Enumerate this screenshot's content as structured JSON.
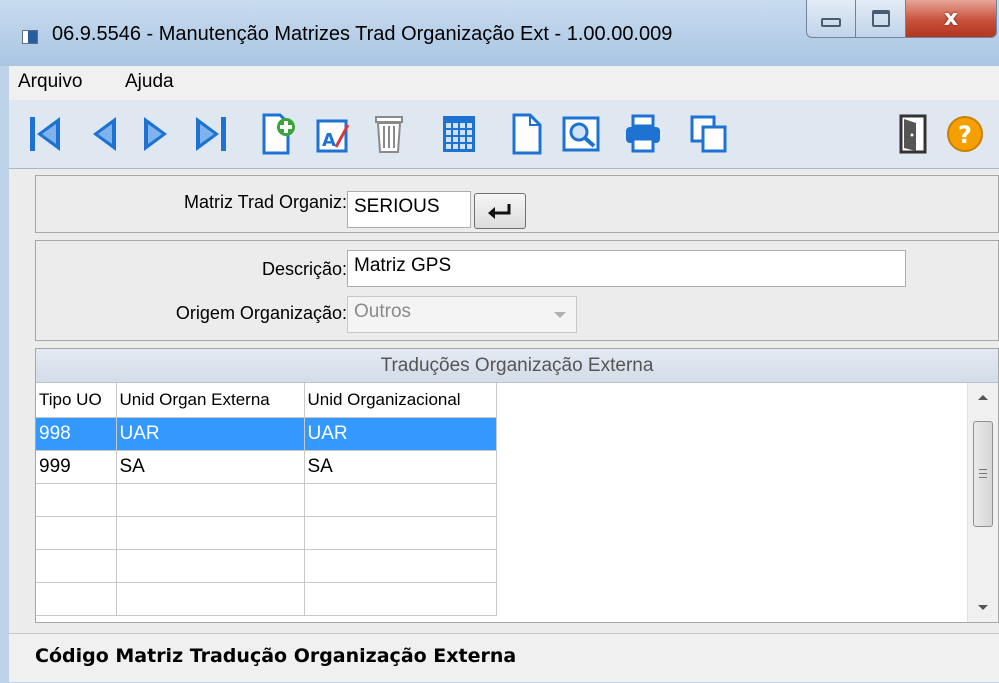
{
  "window": {
    "title": "06.9.5546 - Manutenção Matrizes Trad Organização Ext - 1.00.00.009"
  },
  "menu": {
    "items": [
      "Arquivo",
      "Ajuda"
    ]
  },
  "toolbar": {
    "icons": [
      "first-record-icon",
      "previous-record-icon",
      "next-record-icon",
      "last-record-icon",
      "add-record-icon",
      "edit-record-icon",
      "delete-record-icon",
      "calendar-grid-icon",
      "blank-document-icon",
      "print-preview-icon",
      "printer-icon",
      "copy-icon",
      "exit-door-icon",
      "help-icon"
    ]
  },
  "key_panel": {
    "label": "Matriz Trad Organiz:",
    "value": "SERIOUS"
  },
  "detail_panel": {
    "descricao_label": "Descrição:",
    "descricao_value": "Matriz GPS",
    "origem_label": "Origem Organização:",
    "origem_value": "Outros"
  },
  "grid": {
    "title": "Traduções Organização Externa",
    "columns": [
      "Tipo UO",
      "Unid Organ Externa",
      "Unid Organizacional"
    ],
    "rows": [
      {
        "tipo": "998",
        "externa": "UAR",
        "organizacional": "UAR",
        "selected": true
      },
      {
        "tipo": "999",
        "externa": "SA",
        "organizacional": "SA",
        "selected": false
      }
    ]
  },
  "status": {
    "text": "Código Matriz Tradução Organização Externa"
  },
  "colors": {
    "selection": "#3399ff",
    "toolbar_icon": "#1e73d2",
    "help": "#f5a000"
  }
}
